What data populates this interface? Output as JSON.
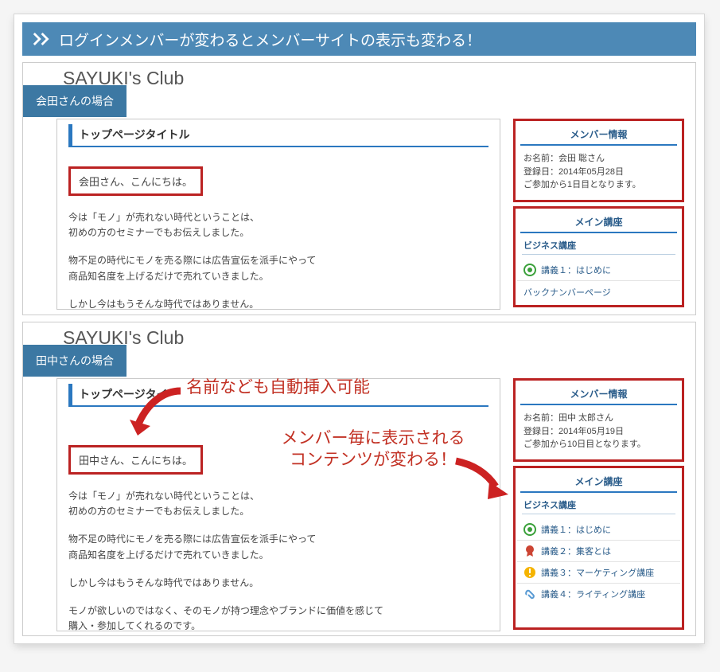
{
  "banner": {
    "title": "ログインメンバーが変わるとメンバーサイトの表示も変わる！"
  },
  "callouts": {
    "name_insert": "名前なども自動挿入可能",
    "content_changes_1": "メンバー毎に表示される",
    "content_changes_2": "コンテンツが変わる！"
  },
  "scenes": [
    {
      "badge": "会田さんの場合",
      "club": "SAYUKI's Club",
      "page_title": "トップページタイトル",
      "greeting": "会田さん、こんにちは。",
      "para1": "今は「モノ」が売れない時代ということは、",
      "para2": "初めの方のセミナーでもお伝えしました。",
      "para3": "物不足の時代にモノを売る際には広告宣伝を派手にやって",
      "para4": "商品知名度を上げるだけで売れていきました。",
      "para5": "しかし今はもうそんな時代ではありません。",
      "member_info": {
        "title": "メンバー情報",
        "name": "お名前：会田 聡さん",
        "regdate": "登録日：2014年05月28日",
        "days": "ご参加から1日目となります。"
      },
      "lecture": {
        "title": "メイン講座",
        "sub": "ビジネス講座",
        "lessons": [
          {
            "icon": "bullseye",
            "label": "講義１：はじめに"
          }
        ],
        "backnumber": "バックナンバーページ"
      }
    },
    {
      "badge": "田中さんの場合",
      "club": "SAYUKI's Club",
      "page_title": "トップページタイ",
      "greeting": "田中さん、こんにちは。",
      "para1": "今は「モノ」が売れない時代ということは、",
      "para2": "初めの方のセミナーでもお伝えしました。",
      "para3": "物不足の時代にモノを売る際には広告宣伝を派手にやって",
      "para4": "商品知名度を上げるだけで売れていきました。",
      "para5": "しかし今はもうそんな時代ではありません。",
      "para6": "モノが欲しいのではなく、そのモノが持つ理念やブランドに価値を感じて",
      "para7": "購入・参加してくれるのです。",
      "member_info": {
        "title": "メンバー情報",
        "name": "お名前：田中 太郎さん",
        "regdate": "登録日：2014年05月19日",
        "days": "ご参加から10日目となります。"
      },
      "lecture": {
        "title": "メイン講座",
        "sub": "ビジネス講座",
        "lessons": [
          {
            "icon": "bullseye",
            "label": "講義１：はじめに"
          },
          {
            "icon": "ribbon",
            "label": "講義２：集客とは"
          },
          {
            "icon": "warning",
            "label": "講義３：マーケティング講座"
          },
          {
            "icon": "clip",
            "label": "講義４：ライティング講座"
          }
        ]
      }
    }
  ]
}
